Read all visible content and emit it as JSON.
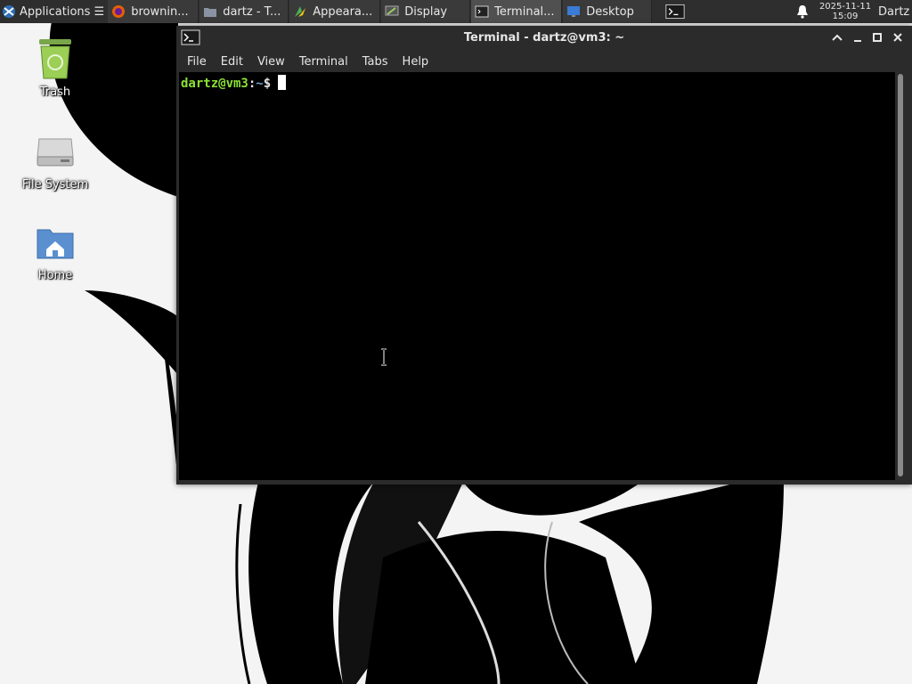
{
  "panel": {
    "applications_label": "Applications ☰",
    "tasks": [
      {
        "label": "brownin...",
        "icon": "firefox-icon"
      },
      {
        "label": "dartz - T...",
        "icon": "folder-icon"
      },
      {
        "label": "Appeara...",
        "icon": "appearance-icon"
      },
      {
        "label": "Display",
        "icon": "display-icon"
      },
      {
        "label": "Terminal...",
        "icon": "terminal-icon"
      },
      {
        "label": "Desktop",
        "icon": "desktop-icon"
      }
    ],
    "date": "2025-11-11",
    "time": "15:09",
    "user": "Dartz"
  },
  "desktop": {
    "icons": [
      {
        "label": "Trash",
        "icon": "trash-icon"
      },
      {
        "label": "File System",
        "icon": "drive-icon"
      },
      {
        "label": "Home",
        "icon": "home-folder-icon"
      }
    ]
  },
  "terminal": {
    "title": "Terminal - dartz@vm3: ~",
    "menu": [
      "File",
      "Edit",
      "View",
      "Terminal",
      "Tabs",
      "Help"
    ],
    "prompt_user": "dartz@vm3",
    "prompt_sep": ":",
    "prompt_path": "~",
    "prompt_symbol": "$",
    "colors": {
      "user": "#8ae234",
      "path": "#729fcf",
      "background": "#000000"
    }
  }
}
